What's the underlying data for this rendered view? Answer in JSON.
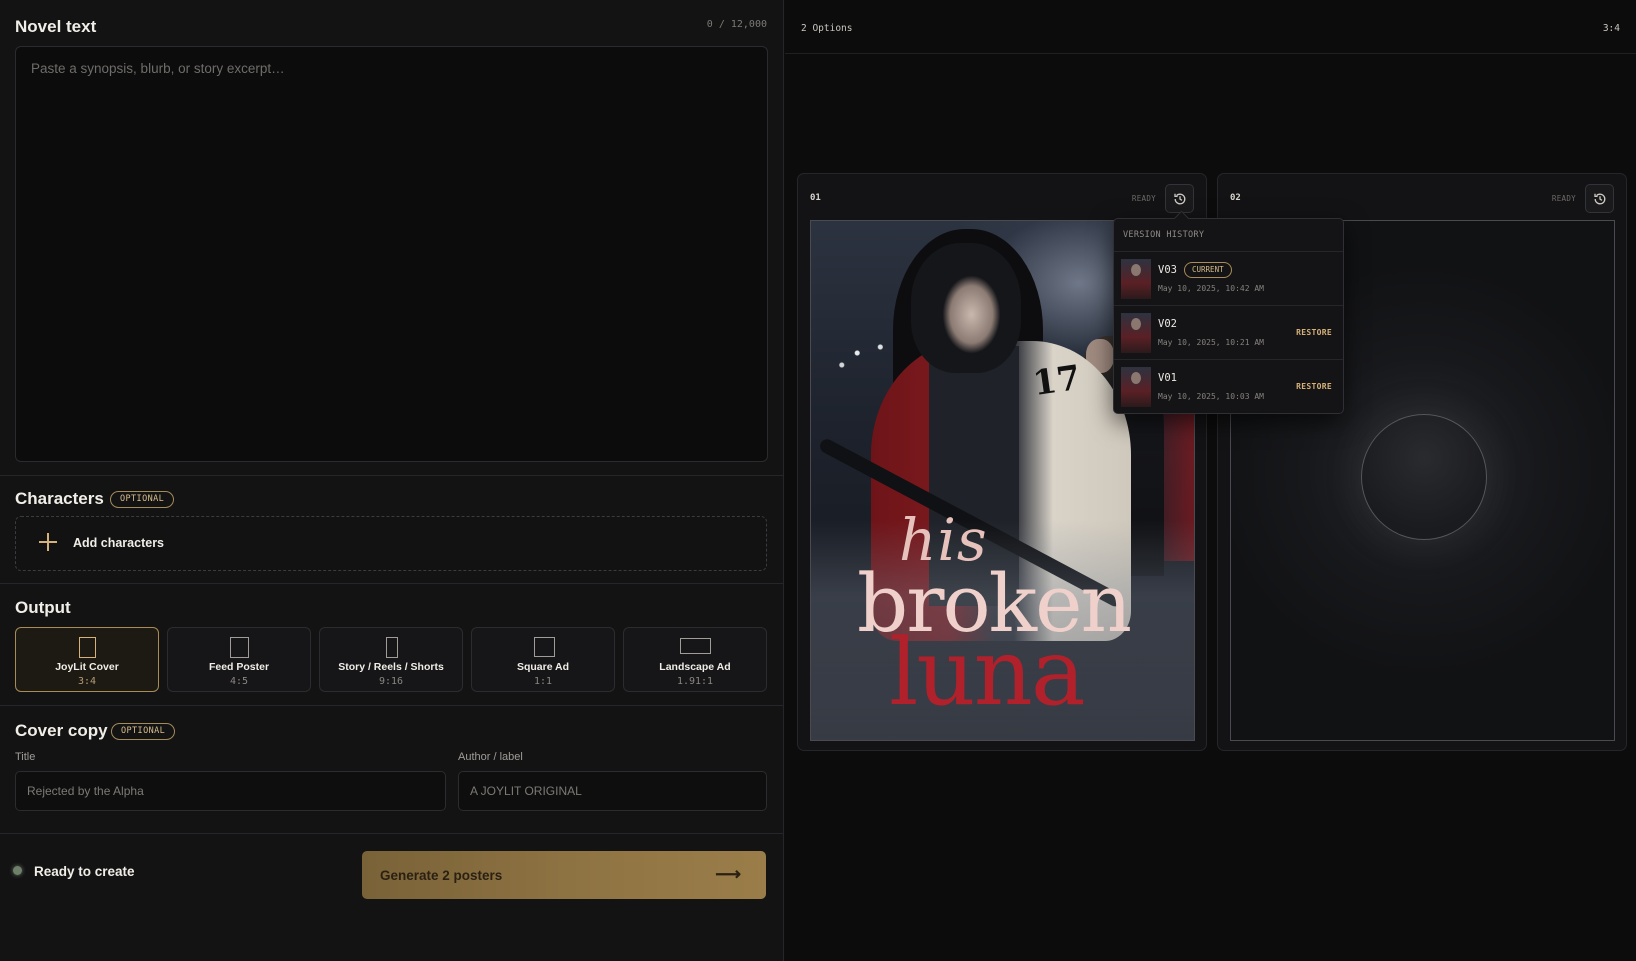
{
  "novel": {
    "title": "Novel text",
    "counter": "0 / 12,000",
    "placeholder": "Paste a synopsis, blurb, or story excerpt…"
  },
  "characters": {
    "title": "Characters",
    "badge": "OPTIONAL",
    "add_label": "Add characters"
  },
  "output": {
    "title": "Output",
    "options": [
      {
        "name": "JoyLit Cover",
        "ratio": "3:4",
        "selected": true
      },
      {
        "name": "Feed Poster",
        "ratio": "4:5",
        "selected": false
      },
      {
        "name": "Story / Reels / Shorts",
        "ratio": "9:16",
        "selected": false
      },
      {
        "name": "Square Ad",
        "ratio": "1:1",
        "selected": false
      },
      {
        "name": "Landscape Ad",
        "ratio": "1.91:1",
        "selected": false
      }
    ]
  },
  "cover_copy": {
    "title": "Cover copy",
    "badge": "OPTIONAL",
    "title_label": "Title",
    "title_placeholder": "Rejected by the Alpha",
    "author_label": "Author / label",
    "author_placeholder": "A JOYLIT ORIGINAL"
  },
  "footer": {
    "status": "Ready to create",
    "generate_label": "Generate 2 posters",
    "generate_arrow": "⟶"
  },
  "results": {
    "options_count": "2 Options",
    "ratio": "3:4",
    "cards": [
      {
        "num": "01",
        "status": "READY"
      },
      {
        "num": "02",
        "status": "READY"
      }
    ],
    "poster_text": {
      "line1": "his",
      "line2": "broken",
      "line3": "luna",
      "jersey": "17"
    }
  },
  "history": {
    "title": "VERSION HISTORY",
    "versions": [
      {
        "version": "V03",
        "date": "May 10, 2025, 10:42 AM",
        "current_label": "CURRENT"
      },
      {
        "version": "V02",
        "date": "May 10, 2025, 10:21 AM",
        "action": "RESTORE"
      },
      {
        "version": "V01",
        "date": "May 10, 2025, 10:03 AM",
        "action": "RESTORE"
      }
    ]
  },
  "colors": {
    "accent": "#d6b27a",
    "button": "#8f7443",
    "poster_red": "#b0212b",
    "status_dot": "#6e7f6a"
  },
  "icons": {
    "history": "history-icon",
    "add": "plus-icon",
    "arrow": "arrow-right-icon"
  }
}
